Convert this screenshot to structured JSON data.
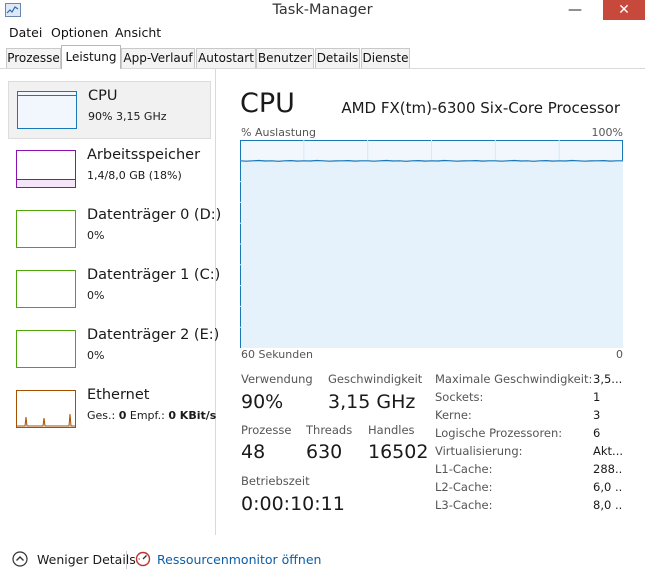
{
  "window": {
    "title": "Task-Manager",
    "minimize": "—",
    "maximize": "□",
    "close": "✕"
  },
  "menu": [
    "Datei",
    "Optionen",
    "Ansicht"
  ],
  "tabs": [
    "Prozesse",
    "Leistung",
    "App-Verlauf",
    "Autostart",
    "Benutzer",
    "Details",
    "Dienste"
  ],
  "active_tab": "Leistung",
  "sidebar": [
    {
      "name": "CPU",
      "sub": "90% 3,15 GHz",
      "color": "#1979b8"
    },
    {
      "name": "Arbeitsspeicher",
      "sub": "1,4/8,0 GB (18%)",
      "color": "#8b12ae"
    },
    {
      "name": "Datenträger 0 (D:)",
      "sub": "0%",
      "color": "#4da60c"
    },
    {
      "name": "Datenträger 1 (C:)",
      "sub": "0%",
      "color": "#4da60c"
    },
    {
      "name": "Datenträger 2 (E:)",
      "sub": "0%",
      "color": "#4da60c"
    },
    {
      "name": "Ethernet",
      "sub_prefix": "Ges.: ",
      "sub_send": "0",
      "sub_mid": "Empf.: ",
      "sub_recv": "0 KBit/s",
      "color": "#a74f01"
    }
  ],
  "main": {
    "title": "CPU",
    "model": "AMD FX(tm)-6300 Six-Core Processor",
    "axis_top_left": "% Auslastung",
    "axis_top_right": "100%",
    "axis_bottom_left": "60 Sekunden",
    "axis_bottom_right": "0",
    "usage_percent": 90,
    "stats": {
      "usage_label": "Verwendung",
      "usage_value": "90%",
      "speed_label": "Geschwindigkeit",
      "speed_value": "3,15 GHz",
      "processes_label": "Prozesse",
      "processes_value": "48",
      "threads_label": "Threads",
      "threads_value": "630",
      "handles_label": "Handles",
      "handles_value": "16502",
      "uptime_label": "Betriebszeit",
      "uptime_value": "0:00:10:11"
    },
    "details": [
      {
        "label": "Maximale Geschwindigkeit:",
        "value": "3,5..."
      },
      {
        "label": "Sockets:",
        "value": "1"
      },
      {
        "label": "Kerne:",
        "value": "3"
      },
      {
        "label": "Logische Prozessoren:",
        "value": "6"
      },
      {
        "label": "Virtualisierung:",
        "value": "Akt..."
      },
      {
        "label": "L1-Cache:",
        "value": "288..."
      },
      {
        "label": "L2-Cache:",
        "value": "6,0 ..."
      },
      {
        "label": "L3-Cache:",
        "value": "8,0 ..."
      }
    ]
  },
  "footer": {
    "fewer_details": "Weniger Details",
    "resource_monitor": "Ressourcenmonitor öffnen"
  }
}
